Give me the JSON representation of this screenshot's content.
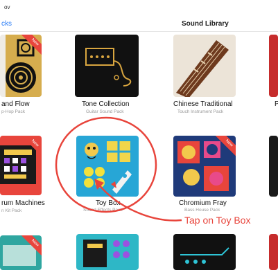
{
  "status_bar": {
    "text": "ov"
  },
  "nav": {
    "back_label": "cks",
    "title": "Sound Library"
  },
  "badge": {
    "label": "New"
  },
  "packs": [
    {
      "name": "and Flow",
      "subtitle": "p-Hop Pack"
    },
    {
      "name": "Tone Collection",
      "subtitle": "Guitar Sound Pack"
    },
    {
      "name": "Chinese Traditional",
      "subtitle": "Touch Instrument Pack"
    },
    {
      "name": "rum Machines",
      "subtitle": "n Kit Pack"
    },
    {
      "name": "Toy Box",
      "subtitle": "Sound Effects Pack"
    },
    {
      "name": "Chromium Fray",
      "subtitle": "Bass House Pack"
    },
    {
      "name": "P",
      "subtitle": ""
    }
  ],
  "annotation": {
    "callout": "Tap on Toy Box",
    "color": "#e8453c"
  },
  "colors": {
    "accent": "#2a7df6",
    "badge": "#e8453c"
  }
}
